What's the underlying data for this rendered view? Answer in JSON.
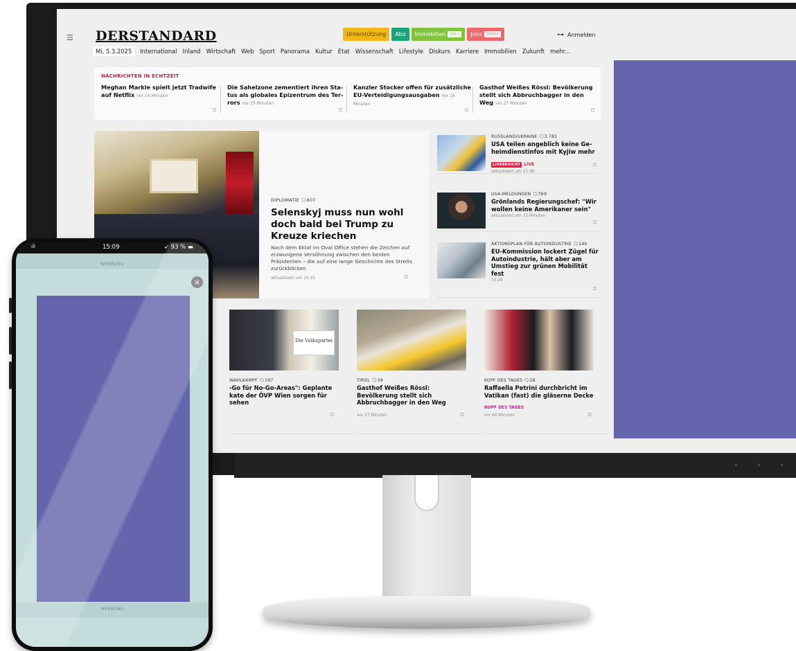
{
  "site": {
    "logo": "DERSTANDARD",
    "logo_chevron": "⌄",
    "menu_icon": "☰",
    "pills": [
      {
        "label": "Unterstützung",
        "tag": "",
        "color": "#f2b718",
        "text_color": "#5a3d00"
      },
      {
        "label": "Abo",
        "tag": "",
        "color": "#19a57a",
        "text_color": "#ffffff"
      },
      {
        "label": "Immobilien",
        "tag": "30k+",
        "color": "#7fc33f",
        "text_color": "#ffffff"
      },
      {
        "label": "Jobs",
        "tag": "3000+",
        "color": "#ee6a6a",
        "text_color": "#ffffff"
      }
    ],
    "login_icon": "key-icon",
    "login": "Anmelden",
    "date": "Mi, 5.3.2025",
    "nav": [
      "International",
      "Inland",
      "Wirtschaft",
      "Web",
      "Sport",
      "Panorama",
      "Kultur",
      "Etat",
      "Wissenschaft",
      "Lifestyle",
      "Diskurs",
      "Karriere",
      "Immobilien",
      "Zukunft",
      "mehr..."
    ],
    "ticker": {
      "title": "NACHRICHTEN IN ECHTZEIT",
      "items": [
        {
          "headline": "Meghan Markle spielt jetzt Tradwife auf Netflix",
          "time": "vor 14 Minuten"
        },
        {
          "headline": "Die Sahelzone zementiert ihren Sta-tus als globales Epizentrum des Ter-rors",
          "time": "vor 15 Minuten"
        },
        {
          "headline": "Kanzler Stocker offen für zusätzliche EU-Verteidigungsausgaben",
          "time": "vor 18 Minuten"
        },
        {
          "headline": "Gasthof Weißes Rössl: Bevölkerung stellt sich Abbruchbagger in den Weg",
          "time": "vor 27 Minuten"
        }
      ]
    },
    "hero": {
      "kicker": "DIPLOMATIE  🗨607",
      "title": "Selenskyj muss nun wohl doch bald bei Trump zu Kreuze kriechen",
      "teaser": "Nach dem Eklat im Oval Office stehen die Zeichen auf erzwungene Versöhnung zwischen den beiden Präsidenten – die auf eine lange Geschichte des Streits zurückblicken",
      "time": "aktualisiert um 15:41"
    },
    "side": [
      {
        "kicker": "RUSSLAND/UKRAINE  🗨3.781",
        "headline": "USA teilen angeblich keine Ge-heimdienstinfos mit Kyjiw mehr",
        "badge": "LIVEBERICHT",
        "badge2": "LIVE",
        "time": "aktualisiert um 13:48"
      },
      {
        "kicker": "USA-MELDUNGEN  🗨769",
        "headline": "Grönlands Regierungschef: \"Wir wollen keine Amerikaner sein\"",
        "badge": "",
        "badge2": "",
        "time": "aktualisiert vor 33 Minuten"
      },
      {
        "kicker": "AKTIONSPLAN FÜR AUTOINDUSTRIE  🗨140",
        "headline": "EU-Kommission lockert Zügel für Autoindustrie, hält aber am Umstieg zur grünen Mobilität fest",
        "badge": "",
        "badge2": "",
        "time": "15:29"
      }
    ],
    "cards": [
      {
        "kicker": "WAHLKAMPF  🗨197",
        "headline": "-Go für No-Go-Areas\": Geplante kate der ÖVP Wien sorgen für sehen",
        "pink": "",
        "time": ""
      },
      {
        "kicker": "TIROL  🗨39",
        "headline": "Gasthof Weißes Rössl: Bevölkerung stellt sich Abbruchbagger in den Weg",
        "pink": "",
        "time": "vor 27 Minuten"
      },
      {
        "kicker": "KOPF DES TAGES  🗨28",
        "headline": "Raffaella Petrini durchbricht im Vatikan (fast) die gläserne Decke",
        "pink": "KOPF DES TAGES",
        "time": "vor 60 Minuten"
      }
    ],
    "card_image_label": "Die Volkspartei",
    "bookmark_icon": "bookmark-icon",
    "ad_color": "#6565ad"
  },
  "phone": {
    "time": "15:09",
    "battery": "93 %",
    "signal": "ıll",
    "werbung_top": "WERBUNG",
    "werbung_bottom": "WERBUNG",
    "close_icon": "×",
    "ad_color": "#6565ad",
    "screen_color": "#c4dcdc"
  }
}
